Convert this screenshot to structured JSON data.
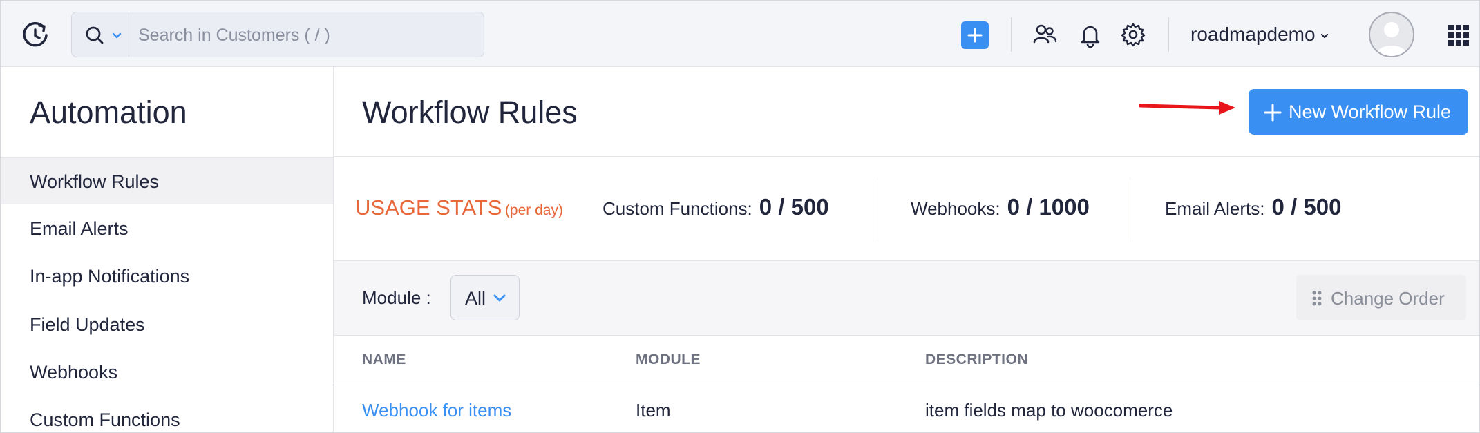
{
  "topbar": {
    "search": {
      "placeholder": "Search in Customers ( / )"
    },
    "org_name": "roadmapdemo",
    "icons": [
      "history-icon",
      "search-icon",
      "chevron-down-icon",
      "plus-icon",
      "contacts-icon",
      "bell-icon",
      "gear-icon",
      "avatar",
      "apps-grid-icon"
    ]
  },
  "sidebar": {
    "title": "Automation",
    "items": [
      {
        "label": "Workflow Rules",
        "active": true
      },
      {
        "label": "Email Alerts",
        "active": false
      },
      {
        "label": "In-app Notifications",
        "active": false
      },
      {
        "label": "Field Updates",
        "active": false
      },
      {
        "label": "Webhooks",
        "active": false
      },
      {
        "label": "Custom Functions",
        "active": false
      }
    ]
  },
  "main": {
    "title": "Workflow Rules",
    "new_button_label": "New Workflow Rule",
    "usage": {
      "label": "USAGE STATS",
      "sublabel": "(per day)",
      "stats": [
        {
          "key": "Custom Functions:",
          "value": "0 / 500"
        },
        {
          "key": "Webhooks:",
          "value": "0 / 1000"
        },
        {
          "key": "Email Alerts:",
          "value": "0 / 500"
        }
      ]
    },
    "filter": {
      "module_label": "Module :",
      "module_value": "All",
      "change_order_label": "Change Order"
    },
    "table": {
      "columns": [
        "NAME",
        "MODULE",
        "DESCRIPTION"
      ],
      "rows": [
        {
          "name": "Webhook for items",
          "module": "Item",
          "description": "item fields map to woocomerce"
        }
      ]
    }
  },
  "colors": {
    "accent": "#3a8ff2",
    "usage_orange": "#e8683a",
    "annotation_arrow": "#e8151b",
    "topbar_bg": "#f4f5f9"
  }
}
